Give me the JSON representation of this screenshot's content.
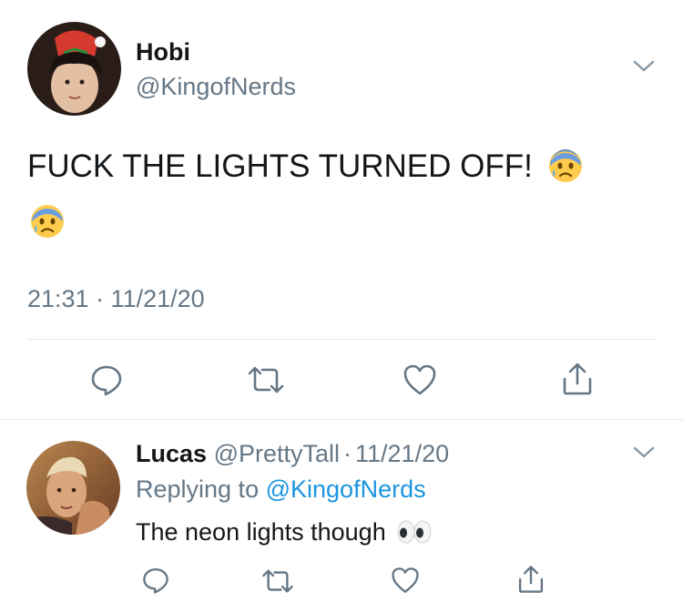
{
  "main_tweet": {
    "author_name": "Hobi",
    "author_handle": "@KingofNerds",
    "text": "FUCK THE LIGHTS TURNED OFF!",
    "emojis": [
      "anxious-face-with-sweat",
      "anxious-face-with-sweat"
    ],
    "timestamp": "21:31 · 11/21/20",
    "actions": [
      "reply",
      "retweet",
      "like",
      "share"
    ]
  },
  "reply_tweet": {
    "author_name": "Lucas",
    "author_handle": "@PrettyTall",
    "date": "11/21/20",
    "separator": "·",
    "replying_label": "Replying to",
    "replying_handle": "@KingofNerds",
    "text": "The neon lights though",
    "emojis": [
      "eyes"
    ],
    "actions": [
      "reply",
      "retweet",
      "like",
      "share"
    ]
  },
  "colors": {
    "text": "#14171a",
    "muted": "#657786",
    "link": "#1b95e0",
    "divider": "#e1e8ed"
  }
}
